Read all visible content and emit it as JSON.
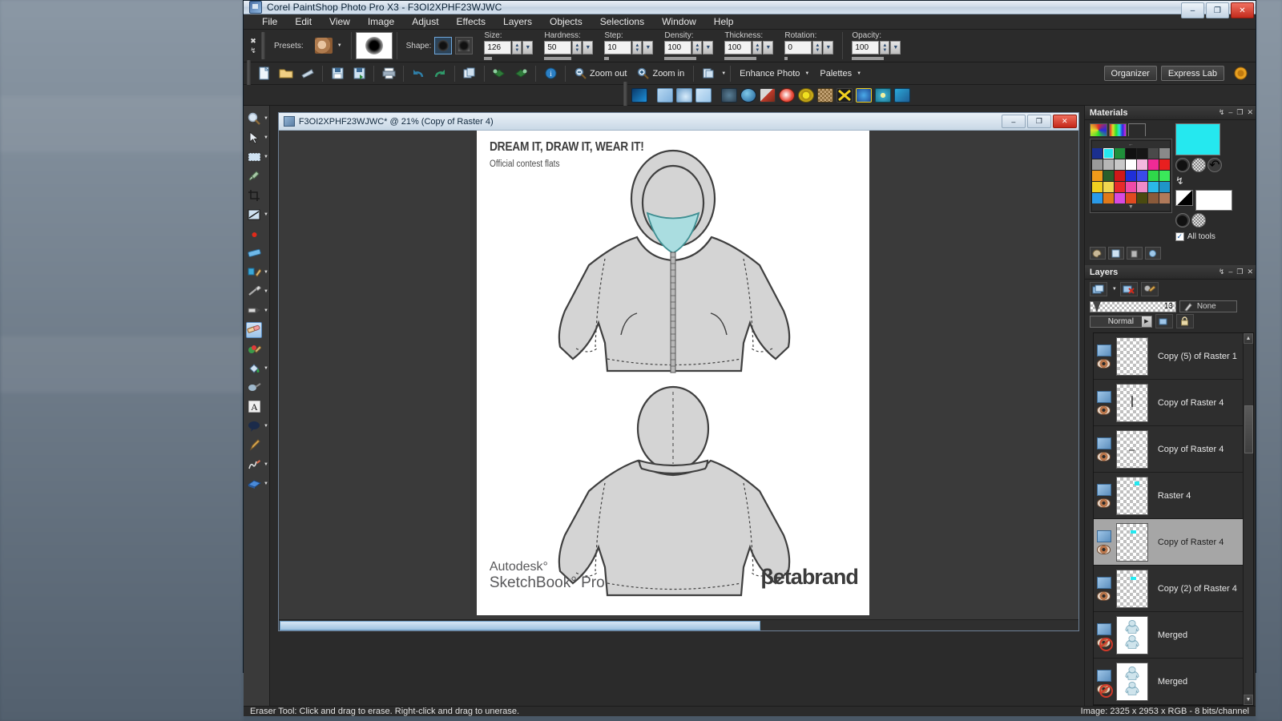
{
  "window": {
    "title": "Corel PaintShop Photo Pro X3 - F3OI2XPHF23WJWC",
    "minimize": "–",
    "maximize": "❐",
    "close": "✕"
  },
  "menubar": [
    "File",
    "Edit",
    "View",
    "Image",
    "Adjust",
    "Effects",
    "Layers",
    "Objects",
    "Selections",
    "Window",
    "Help"
  ],
  "options_bar": {
    "close_glyph": "✖",
    "pin_glyph": "↯",
    "presets_label": "Presets:",
    "shape_label": "Shape:",
    "fields": [
      {
        "label": "Size:",
        "value": "126"
      },
      {
        "label": "Hardness:",
        "value": "50"
      },
      {
        "label": "Step:",
        "value": "10"
      },
      {
        "label": "Density:",
        "value": "100"
      },
      {
        "label": "Thickness:",
        "value": "100"
      },
      {
        "label": "Rotation:",
        "value": "0"
      },
      {
        "label": "Opacity:",
        "value": "100"
      }
    ]
  },
  "standard_toolbar": {
    "icons": [
      "new-icon",
      "open-icon",
      "browse-icon",
      "save-icon",
      "save-as-icon",
      "print-icon",
      "undo-icon",
      "redo-icon",
      "duplicate-icon",
      "rotate-left-icon",
      "rotate-right-icon",
      "info-icon"
    ],
    "zoom_out": "Zoom out",
    "zoom_in": "Zoom in",
    "enhance_photo": "Enhance Photo",
    "palettes": "Palettes",
    "organizer": "Organizer",
    "express_lab": "Express Lab"
  },
  "effects_toolbar": {
    "colors": [
      "#1e90d8",
      "#9fc8ea",
      "#8fc0e6",
      "#b7d8f2",
      "#5a7f96",
      "#2f6fa8",
      "#b03a2a",
      "#d84a3a",
      "#d8c420",
      "#8a6a3a",
      "#e8d020",
      "#2a6fd8",
      "#3ac8e8",
      "#1e78c8"
    ]
  },
  "tool_palette": [
    "zoom-tool",
    "pick-tool",
    "selection-tool",
    "dropper-tool",
    "crop-tool",
    "straighten-tool",
    "red-eye-tool",
    "makeover-tool",
    "clone-tool",
    "scratch-remover-tool",
    "paint-brush-tool",
    "eraser-tool",
    "art-media-tool",
    "flood-fill-tool",
    "smudge-tool",
    "text-tool",
    "speech-bubble-tool",
    "pen-tool",
    "warp-tool",
    "object-tool"
  ],
  "document": {
    "title": "F3OI2XPHF23WJWC* @  21% (Copy of Raster 4)",
    "minimize": "–",
    "restore": "❐",
    "close": "✕",
    "canvas": {
      "headline": "DREAM IT, DRAW IT, WEAR IT!",
      "subtitle": "Official contest flats",
      "logo_autodesk_line1": "Autodesk°",
      "logo_autodesk_line2": "SketchBook",
      "logo_autodesk_line2b": "° Pro",
      "logo_betabrand": "βetabrand",
      "garment_fill": "#d4d4d4",
      "garment_stroke": "#3f3f3f",
      "hood_accent": "#aadde0"
    }
  },
  "materials": {
    "title": "Materials",
    "pin": "↯",
    "minimize": "–",
    "maximize": "❐",
    "close": "✕",
    "tabs": [
      "frame-tab",
      "rainbow-tab",
      "swatches-tab"
    ],
    "foreground_color": "#25e8ef",
    "up_arrow": "←",
    "down_arrow": "▼",
    "all_tools_label": "All tools",
    "all_tools_checked": "✓",
    "swatches": [
      "#1b2f8f",
      "#25e8ef",
      "#1f8f3a",
      "#111111",
      "#161616",
      "#4a4a4a",
      "#8a8a8a",
      "#9a9a9a",
      "#b6b6b6",
      "#c8c8c8",
      "#ffffff",
      "#f3b8e0",
      "#ef2a95",
      "#e81f1f",
      "#f09a1a",
      "#2b5f2b",
      "#d01818",
      "#1f2fd8",
      "#3a4ae8",
      "#2fd84a",
      "#3ae85a",
      "#f0d020",
      "#f0d850",
      "#e82a2a",
      "#f04aa8",
      "#f08ac8",
      "#2ab8e8",
      "#1f95c8",
      "#2a9ae8",
      "#e07a1a",
      "#d84ae0",
      "#e04a20",
      "#4a4a10",
      "#8a5a3a",
      "#b07a5a"
    ]
  },
  "layers_panel": {
    "title": "Layers",
    "pin": "↯",
    "minimize": "–",
    "maximize": "❐",
    "close": "✕",
    "opacity_value": "13",
    "none_label": "None",
    "blend_mode": "Normal",
    "layers": [
      {
        "name": "Merged",
        "visible": false,
        "selected": false,
        "thumb": "white"
      },
      {
        "name": "Merged",
        "visible": false,
        "selected": false,
        "thumb": "white"
      },
      {
        "name": "Copy (2) of Raster 4",
        "visible": true,
        "selected": false,
        "thumb": "alpha"
      },
      {
        "name": "Copy of Raster 4",
        "visible": true,
        "selected": true,
        "thumb": "alpha"
      },
      {
        "name": "Raster 4",
        "visible": true,
        "selected": false,
        "thumb": "alpha"
      },
      {
        "name": "Copy of Raster 4",
        "visible": true,
        "selected": false,
        "thumb": "alpha"
      },
      {
        "name": "Copy of Raster 4",
        "visible": true,
        "selected": false,
        "thumb": "alpha"
      },
      {
        "name": "Copy (5) of Raster 1",
        "visible": true,
        "selected": false,
        "thumb": "alpha"
      }
    ]
  },
  "statusbar": {
    "tip": "Eraser Tool: Click and drag to erase. Right-click and drag to unerase.",
    "image_info": "Image:  2325 x 2953 x RGB - 8 bits/channel"
  }
}
